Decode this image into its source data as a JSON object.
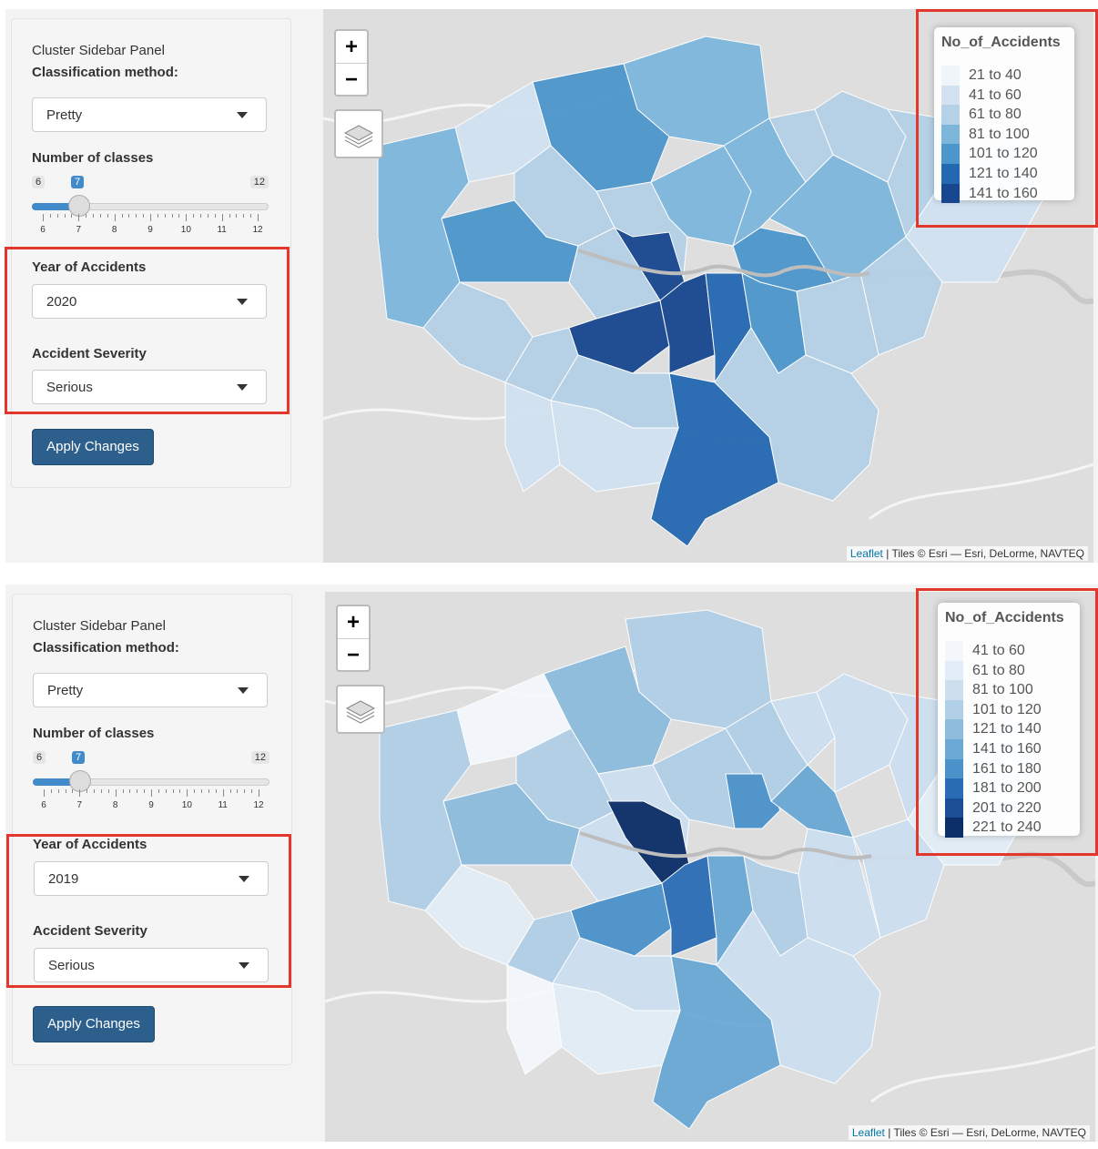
{
  "panels": [
    {
      "sidebar_title": "Cluster Sidebar Panel",
      "classification_label": "Classification method:",
      "classification_value": "Pretty",
      "classes_label": "Number of classes",
      "slider": {
        "min": "6",
        "max": "12",
        "value": "7",
        "ticks": [
          "6",
          "7",
          "8",
          "9",
          "10",
          "11",
          "12"
        ]
      },
      "year_label": "Year of Accidents",
      "year_value": "2020",
      "severity_label": "Accident Severity",
      "severity_value": "Serious",
      "apply_label": "Apply Changes",
      "map": {
        "zoom_in": "+",
        "zoom_out": "−",
        "legend_title": "No_of_Accidents",
        "legend": [
          {
            "label": "21 to 40",
            "color": "#eff5fb"
          },
          {
            "label": "41 to 60",
            "color": "#d2e2f1"
          },
          {
            "label": "61 to 80",
            "color": "#b4d1e7"
          },
          {
            "label": "81 to 100",
            "color": "#7db6db"
          },
          {
            "label": "101 to 120",
            "color": "#4d96cc"
          },
          {
            "label": "121 to 140",
            "color": "#2468b1"
          },
          {
            "label": "141 to 160",
            "color": "#17478f"
          }
        ],
        "attribution_link": "Leaflet",
        "attribution_text": " | Tiles © Esri — Esri, DeLorme, NAVTEQ"
      }
    },
    {
      "sidebar_title": "Cluster Sidebar Panel",
      "classification_label": "Classification method:",
      "classification_value": "Pretty",
      "classes_label": "Number of classes",
      "slider": {
        "min": "6",
        "max": "12",
        "value": "7",
        "ticks": [
          "6",
          "7",
          "8",
          "9",
          "10",
          "11",
          "12"
        ]
      },
      "year_label": "Year of Accidents",
      "year_value": "2019",
      "severity_label": "Accident Severity",
      "severity_value": "Serious",
      "apply_label": "Apply Changes",
      "map": {
        "zoom_in": "+",
        "zoom_out": "−",
        "legend_title": "No_of_Accidents",
        "legend": [
          {
            "label": "41 to 60",
            "color": "#f4f8fc"
          },
          {
            "label": "61 to 80",
            "color": "#e3edf7"
          },
          {
            "label": "81 to 100",
            "color": "#cddeef"
          },
          {
            "label": "101 to 120",
            "color": "#b1cfe6"
          },
          {
            "label": "121 to 140",
            "color": "#8dbcdd"
          },
          {
            "label": "141 to 160",
            "color": "#6aa8d5"
          },
          {
            "label": "161 to 180",
            "color": "#4a92c9"
          },
          {
            "label": "181 to 200",
            "color": "#2a6db5"
          },
          {
            "label": "201 to 220",
            "color": "#1a4f96"
          },
          {
            "label": "221 to 240",
            "color": "#0b2e68"
          }
        ],
        "attribution_link": "Leaflet",
        "attribution_text": " | Tiles © Esri — Esri, DeLorme, NAVTEQ"
      }
    }
  ]
}
